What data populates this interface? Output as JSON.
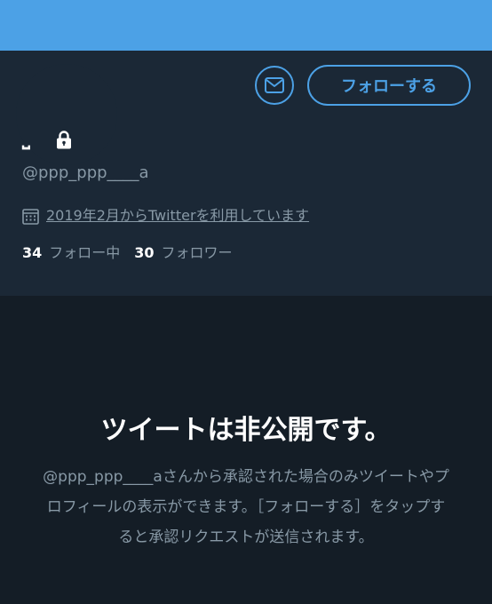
{
  "profile": {
    "display_name": "⎵",
    "handle": "@ppp_ppp____a",
    "protected_icon": "lock-icon",
    "joined": "2019年2月からTwitterを利用しています",
    "joined_icon": "calendar-icon"
  },
  "actions": {
    "dm_icon": "envelope-icon",
    "follow_label": "フォローする"
  },
  "stats": {
    "following_count": "34",
    "following_label": "フォロー中",
    "followers_count": "30",
    "followers_label": "フォロワー"
  },
  "protected": {
    "title": "ツイートは非公開です。",
    "description": "@ppp_ppp____aさんから承認された場合のみツイートやプロフィールの表示ができます。［フォローする］をタップすると承認リクエストが送信されます。"
  },
  "colors": {
    "banner": "#4ca1e6",
    "accent": "#4ca1e6",
    "card_bg": "#1b2836",
    "page_bg": "#141d26",
    "secondary_text": "#8899a6",
    "primary_text": "#ffffff"
  }
}
